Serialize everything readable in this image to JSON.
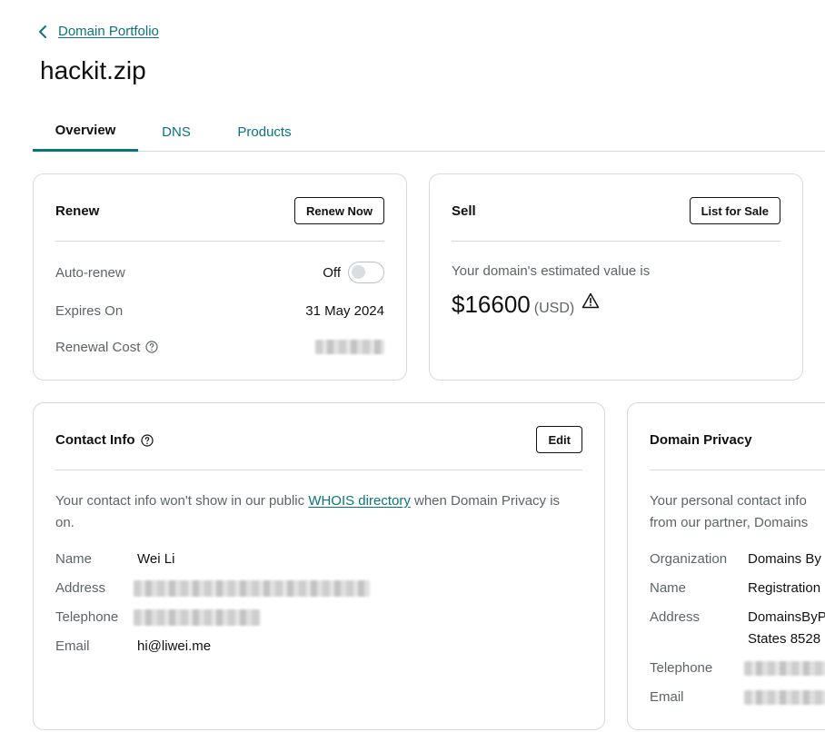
{
  "breadcrumb": {
    "label": "Domain Portfolio"
  },
  "page_title": "hackit.zip",
  "tabs": [
    {
      "label": "Overview",
      "active": true
    },
    {
      "label": "DNS",
      "active": false
    },
    {
      "label": "Products",
      "active": false
    }
  ],
  "renew": {
    "title": "Renew",
    "button": "Renew Now",
    "auto_renew_label": "Auto-renew",
    "auto_renew_value": "Off",
    "auto_renew_enabled": false,
    "expires_label": "Expires On",
    "expires_value": "31 May 2024",
    "renewal_cost_label": "Renewal Cost"
  },
  "sell": {
    "title": "Sell",
    "button": "List for Sale",
    "estimate_text": "Your domain's estimated value is",
    "amount": "$16600",
    "currency": "(USD)"
  },
  "contact": {
    "title": "Contact Info",
    "button": "Edit",
    "info_before": "Your contact info won't show in our public ",
    "info_link": "WHOIS directory",
    "info_after": " when Domain Privacy is on.",
    "fields": {
      "name_label": "Name",
      "name_value": "Wei Li",
      "address_label": "Address",
      "telephone_label": "Telephone",
      "email_label": "Email",
      "email_value": "hi@liwei.me"
    }
  },
  "privacy": {
    "title": "Domain Privacy",
    "info_line1": "Your personal contact info",
    "info_line2": "from our partner, Domains",
    "fields": {
      "organization_label": "Organization",
      "organization_value": "Domains By",
      "name_label": "Name",
      "name_value": "Registration",
      "address_label": "Address",
      "address_line1": "DomainsByP",
      "address_line2": "States 8528",
      "telephone_label": "Telephone",
      "email_label": "Email"
    }
  },
  "colors": {
    "accent": "#09757a",
    "border": "#d4dbe0",
    "muted_text": "#5d6468"
  },
  "icons": [
    "chevron-left-icon",
    "help-icon",
    "warning-icon"
  ]
}
